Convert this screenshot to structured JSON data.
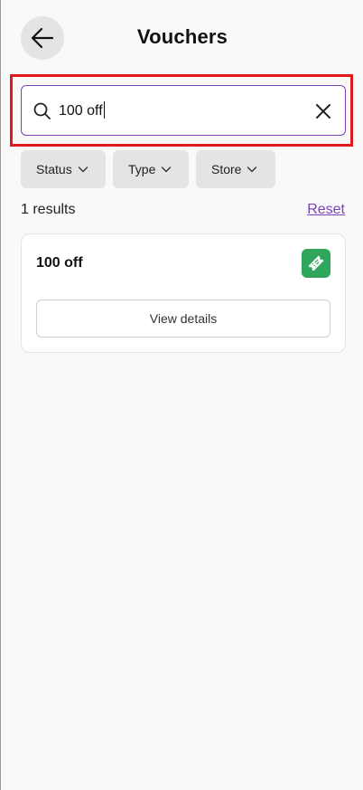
{
  "header": {
    "title": "Vouchers",
    "back_icon": "arrow-left-icon"
  },
  "search": {
    "value": "100 off",
    "search_icon": "search-icon",
    "clear_icon": "close-icon"
  },
  "filters": [
    {
      "label": "Status",
      "icon": "chevron-down-icon"
    },
    {
      "label": "Type",
      "icon": "chevron-down-icon"
    },
    {
      "label": "Store",
      "icon": "chevron-down-icon"
    }
  ],
  "results": {
    "count_text": "1 results",
    "reset_label": "Reset"
  },
  "vouchers": [
    {
      "title": "100 off",
      "icon": "voucher-ticket-icon",
      "button_label": "View details"
    }
  ],
  "colors": {
    "accent": "#7b3fb8",
    "highlight": "#e01a1a",
    "voucher_icon_bg": "#2fa65b",
    "chip_bg": "#e4e4e4"
  }
}
